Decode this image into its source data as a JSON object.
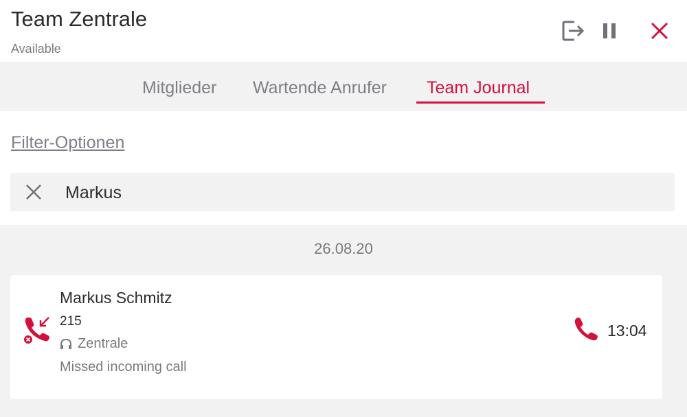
{
  "header": {
    "title": "Team Zentrale",
    "status": "Available",
    "actions": {
      "logout_icon": "logout-icon",
      "pause_icon": "pause-icon",
      "close_icon": "close-icon"
    }
  },
  "tabs": [
    {
      "label": "Mitglieder",
      "active": false
    },
    {
      "label": "Wartende Anrufer",
      "active": false
    },
    {
      "label": "Team Journal",
      "active": true
    }
  ],
  "filter": {
    "link_label": "Filter-Optionen",
    "search_value": "Markus"
  },
  "journal": {
    "date": "26.08.20",
    "entries": [
      {
        "name": "Markus Schmitz",
        "number": "215",
        "team": "Zentrale",
        "status": "Missed incoming call",
        "time": "13:04",
        "icon": "missed-call-icon"
      }
    ]
  },
  "colors": {
    "accent": "#d4103c",
    "muted": "#7d7f86",
    "panel": "#f2f2f2"
  }
}
